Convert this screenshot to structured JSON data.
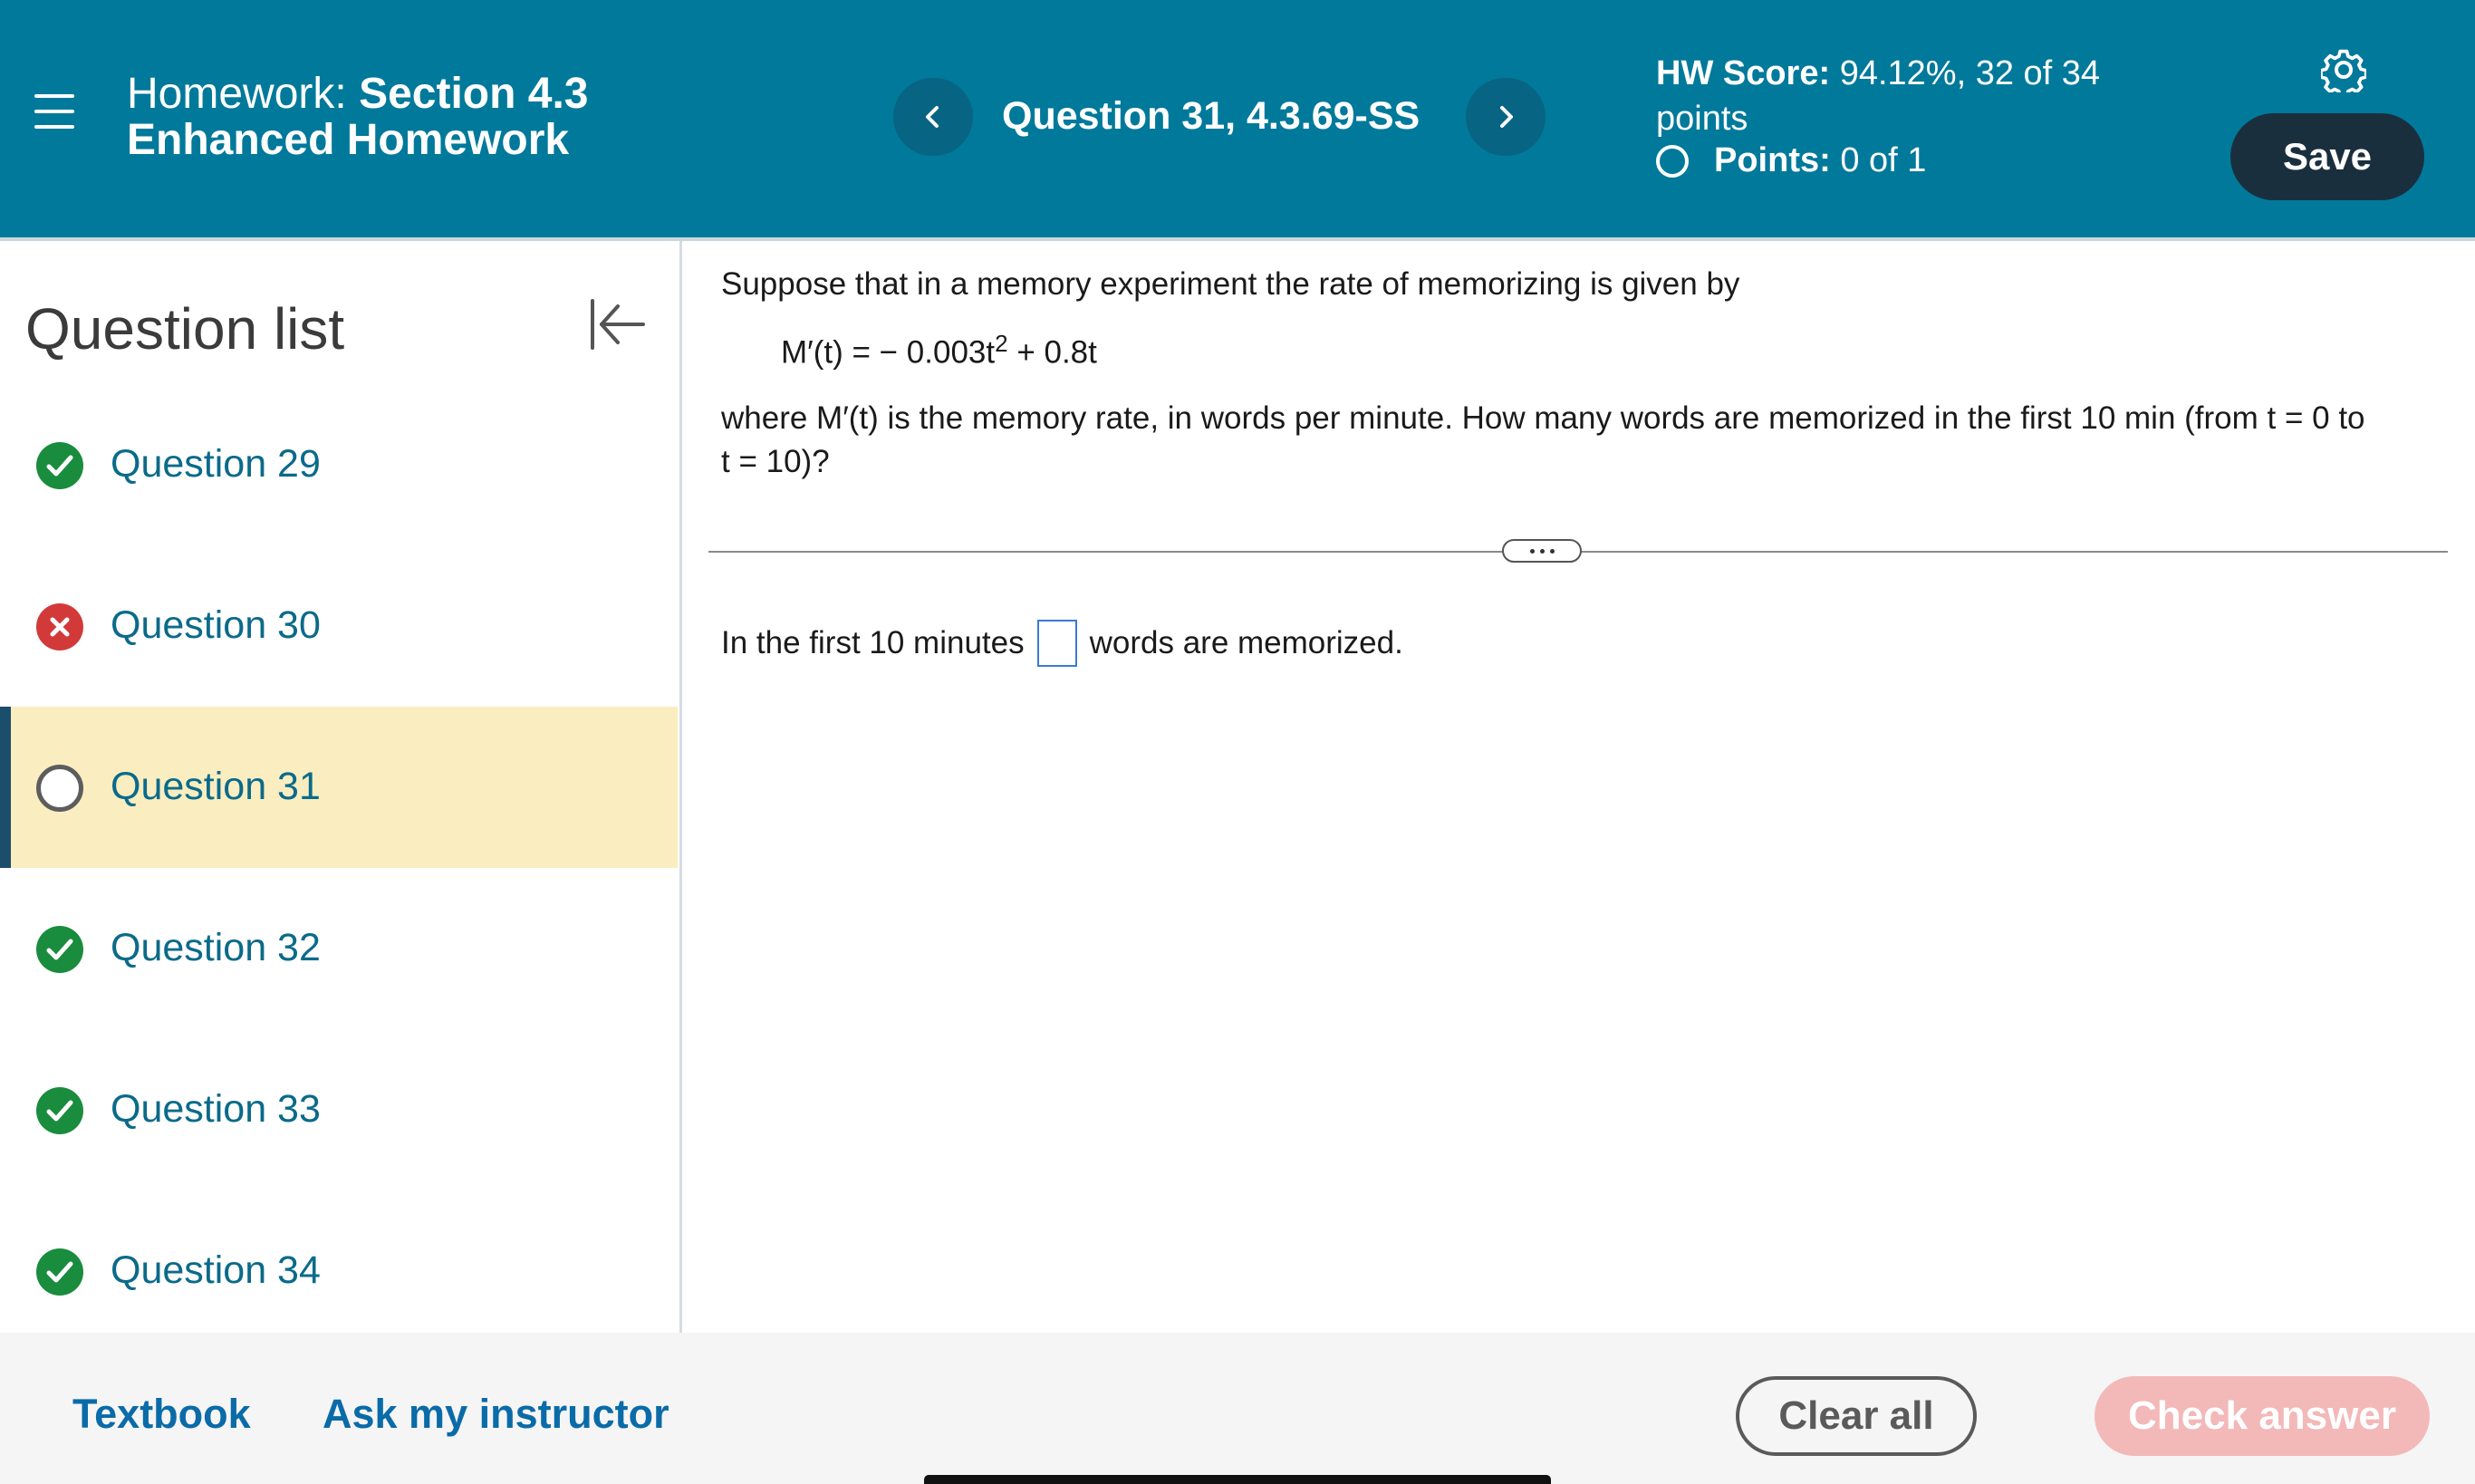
{
  "header": {
    "hw_prefix": "Homework:",
    "hw_section": "Section 4.3",
    "hw_name": "Enhanced Homework",
    "question_title": "Question 31, 4.3.69-SS",
    "score_label": "HW Score:",
    "score_value": "94.12%, 32 of 34",
    "score_suffix": "points",
    "points_label": "Points:",
    "points_value": "0 of 1",
    "save_label": "Save",
    "prev_icon": "chevron-left-icon",
    "next_icon": "chevron-right-icon",
    "settings_icon": "gear-icon"
  },
  "sidebar": {
    "title": "Question list",
    "items": [
      {
        "label": "Question 29",
        "status": "correct"
      },
      {
        "label": "Question 30",
        "status": "incorrect"
      },
      {
        "label": "Question 31",
        "status": "unanswered",
        "active": true
      },
      {
        "label": "Question 32",
        "status": "correct"
      },
      {
        "label": "Question 33",
        "status": "correct"
      },
      {
        "label": "Question 34",
        "status": "correct"
      }
    ]
  },
  "question": {
    "intro": "Suppose that in a memory experiment the rate of memorizing is given by",
    "formula_lhs": "M′(t) = − 0.003t",
    "formula_exp": "2",
    "formula_rhs": " + 0.8t",
    "body_line1": "where M′(t) is the memory rate, in words per minute. How many words are memorized in the first 10 min (from t = 0 to",
    "body_line2": "t = 10)?",
    "answer_prefix": "In the first 10 minutes",
    "answer_suffix": "words are memorized."
  },
  "footer": {
    "textbook": "Textbook",
    "ask_instructor": "Ask my instructor",
    "clear_all": "Clear all",
    "check_answer": "Check answer"
  },
  "colors": {
    "header_bg": "#01799b",
    "save_bg": "#1a2f3e",
    "active_row": "#faedc0",
    "correct": "#1a8c3d",
    "incorrect": "#d23a3a",
    "link": "#0a6ba8",
    "check_disabled": "#f3b8b8"
  }
}
